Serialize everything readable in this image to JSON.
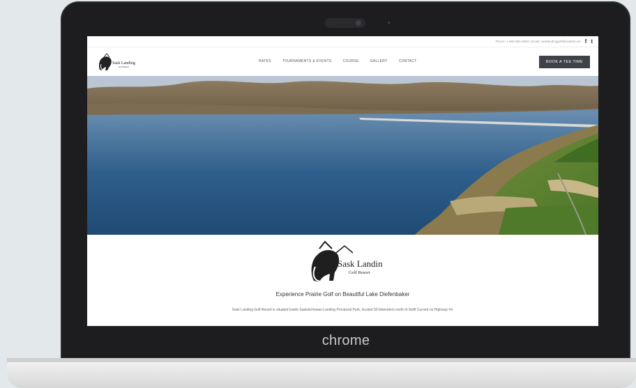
{
  "device": {
    "brand_label": "chrome"
  },
  "site": {
    "topbar": {
      "contact_text": "Phone: 1-866-650-4853 | Email: sasklandinggolf@sasktel.net",
      "facebook_glyph": "f",
      "tumblr_glyph": "t"
    },
    "nav": {
      "logo_alt": "Sask Landing Golf Resort",
      "items": [
        "RATES",
        "TOURNAMENTS & EVENTS",
        "COURSE",
        "GALLERY",
        "CONTACT"
      ],
      "cta": "BOOK A TEE TIME"
    },
    "logo": {
      "line1": "Sask Landing",
      "line2": "Golf Resort"
    },
    "tagline": "Experience Prairie Golf on Beautiful Lake Diefenbaker",
    "description": "Sask Landing Golf Resort is situated inside Saskatchewan Landing Provincial Park, located 50 kilometers north of Swift Current on Highway #4."
  },
  "colors": {
    "button_bg": "#3d4148",
    "bezel": "#1d1d1f",
    "lake": "#2f5f8c"
  },
  "icons": [
    "facebook-icon",
    "tumblr-icon",
    "mammoth-logo-icon",
    "camera-icon"
  ]
}
